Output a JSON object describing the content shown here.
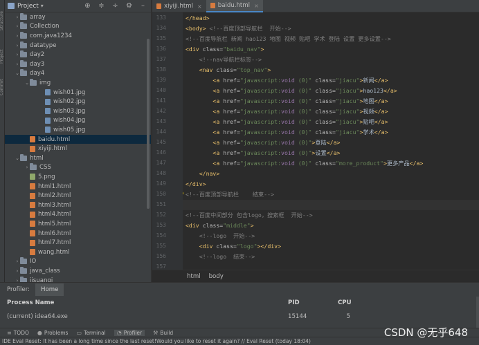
{
  "left_strip": {
    "tabs": [
      "Structure",
      "Project",
      "Commit"
    ]
  },
  "project_panel": {
    "title": "Project",
    "caret": "▾",
    "header_icons": [
      "target-icon",
      "collapse-icon",
      "expand-icon",
      "gear-icon",
      "minimize-icon"
    ]
  },
  "tree": [
    {
      "label": "array",
      "type": "folder",
      "arrow": "›",
      "indent": 1
    },
    {
      "label": "Collection",
      "type": "folder",
      "arrow": "›",
      "indent": 1
    },
    {
      "label": "com.java1234",
      "type": "folder",
      "arrow": "›",
      "indent": 1
    },
    {
      "label": "datatype",
      "type": "folder",
      "arrow": "›",
      "indent": 1
    },
    {
      "label": "day2",
      "type": "folder",
      "arrow": "›",
      "indent": 1
    },
    {
      "label": "day3",
      "type": "folder",
      "arrow": "›",
      "indent": 1
    },
    {
      "label": "day4",
      "type": "folder",
      "arrow": "⌄",
      "indent": 1
    },
    {
      "label": "img",
      "type": "folder",
      "arrow": "⌄",
      "indent": 2
    },
    {
      "label": "wish01.jpg",
      "type": "img",
      "arrow": "",
      "indent": 3
    },
    {
      "label": "wish02.jpg",
      "type": "img",
      "arrow": "",
      "indent": 3
    },
    {
      "label": "wish03.jpg",
      "type": "img",
      "arrow": "",
      "indent": 3
    },
    {
      "label": "wish04.jpg",
      "type": "img",
      "arrow": "",
      "indent": 3
    },
    {
      "label": "wish05.jpg",
      "type": "img",
      "arrow": "",
      "indent": 3
    },
    {
      "label": "baidu.html",
      "type": "html",
      "arrow": "",
      "indent": 2,
      "selected": true
    },
    {
      "label": "xiyiji.html",
      "type": "html",
      "arrow": "",
      "indent": 2
    },
    {
      "label": "html",
      "type": "folder",
      "arrow": "⌄",
      "indent": 1
    },
    {
      "label": "CSS",
      "type": "folder",
      "arrow": "›",
      "indent": 2
    },
    {
      "label": "5.png",
      "type": "png",
      "arrow": "",
      "indent": 2
    },
    {
      "label": "html1.html",
      "type": "html",
      "arrow": "",
      "indent": 2
    },
    {
      "label": "html2.html",
      "type": "html",
      "arrow": "",
      "indent": 2
    },
    {
      "label": "html3.html",
      "type": "html",
      "arrow": "",
      "indent": 2
    },
    {
      "label": "html4.html",
      "type": "html",
      "arrow": "",
      "indent": 2
    },
    {
      "label": "html5.html",
      "type": "html",
      "arrow": "",
      "indent": 2
    },
    {
      "label": "html6.html",
      "type": "html",
      "arrow": "",
      "indent": 2
    },
    {
      "label": "html7.html",
      "type": "html",
      "arrow": "",
      "indent": 2
    },
    {
      "label": "wang.html",
      "type": "html",
      "arrow": "",
      "indent": 2
    },
    {
      "label": "IO",
      "type": "folder",
      "arrow": "›",
      "indent": 1
    },
    {
      "label": "java_class",
      "type": "folder",
      "arrow": "›",
      "indent": 1
    },
    {
      "label": "jisuanqi",
      "type": "folder",
      "arrow": "›",
      "indent": 1
    }
  ],
  "editor_tabs": [
    {
      "label": "xiyiji.html",
      "active": false,
      "close": "×"
    },
    {
      "label": "baidu.html",
      "active": true,
      "close": "×"
    }
  ],
  "code_lines": [
    {
      "n": "133",
      "segs": [
        [
          "tg",
          "</head>"
        ]
      ]
    },
    {
      "n": "134",
      "segs": [
        [
          "tg",
          "<body>"
        ],
        [
          "cm",
          " <!--百度顶部导航栏  开始-->"
        ]
      ]
    },
    {
      "n": "135",
      "segs": [
        [
          "cm",
          "<!--百度导航栏 新闻 hao123 地图 视频 贴吧 学术 登陆 设置 更多设置-->"
        ]
      ]
    },
    {
      "n": "136",
      "segs": [
        [
          "tg",
          "<div "
        ],
        [
          "at",
          "class="
        ],
        [
          "av",
          "\"baidu_nav\""
        ],
        [
          "tg",
          ">"
        ]
      ]
    },
    {
      "n": "137",
      "segs": [
        [
          "cm",
          "    <!--nav导航栏标签-->"
        ]
      ]
    },
    {
      "n": "138",
      "segs": [
        [
          "tg",
          "    <nav "
        ],
        [
          "at",
          "class="
        ],
        [
          "av",
          "\"top_nav\""
        ],
        [
          "tg",
          ">"
        ]
      ]
    },
    {
      "n": "139",
      "segs": [
        [
          "tg",
          "        <a "
        ],
        [
          "at",
          "href="
        ],
        [
          "av",
          "\"javascript:"
        ],
        [
          "vd",
          "void "
        ],
        [
          "av",
          "(0)\" "
        ],
        [
          "at",
          "class="
        ],
        [
          "av",
          "\"jiacu\""
        ],
        [
          "tg",
          ">"
        ],
        [
          "tx",
          "新闻"
        ],
        [
          "tg",
          "</a>"
        ]
      ]
    },
    {
      "n": "140",
      "segs": [
        [
          "tg",
          "        <a "
        ],
        [
          "at",
          "href="
        ],
        [
          "av",
          "\"javascript:"
        ],
        [
          "vd",
          "void "
        ],
        [
          "av",
          "(0)\" "
        ],
        [
          "at",
          "class="
        ],
        [
          "av",
          "\"jiacu\""
        ],
        [
          "tg",
          ">"
        ],
        [
          "tx",
          "hao123"
        ],
        [
          "tg",
          "</a>"
        ]
      ]
    },
    {
      "n": "141",
      "segs": [
        [
          "tg",
          "        <a "
        ],
        [
          "at",
          "href="
        ],
        [
          "av",
          "\"javascript:"
        ],
        [
          "vd",
          "void "
        ],
        [
          "av",
          "(0)\" "
        ],
        [
          "at",
          "class="
        ],
        [
          "av",
          "\"jiacu\""
        ],
        [
          "tg",
          ">"
        ],
        [
          "tx",
          "地图"
        ],
        [
          "tg",
          "</a>"
        ]
      ]
    },
    {
      "n": "142",
      "segs": [
        [
          "tg",
          "        <a "
        ],
        [
          "at",
          "href="
        ],
        [
          "av",
          "\"javascript:"
        ],
        [
          "vd",
          "void "
        ],
        [
          "av",
          "(0)\" "
        ],
        [
          "at",
          "class="
        ],
        [
          "av",
          "\"jiacu\""
        ],
        [
          "tg",
          ">"
        ],
        [
          "tx",
          "视频"
        ],
        [
          "tg",
          "</a>"
        ]
      ]
    },
    {
      "n": "143",
      "segs": [
        [
          "tg",
          "        <a "
        ],
        [
          "at",
          "href="
        ],
        [
          "av",
          "\"javascript:"
        ],
        [
          "vd",
          "void "
        ],
        [
          "av",
          "(0)\" "
        ],
        [
          "at",
          "class="
        ],
        [
          "av",
          "\"jiacu\""
        ],
        [
          "tg",
          ">"
        ],
        [
          "tx",
          "贴吧"
        ],
        [
          "tg",
          "</a>"
        ]
      ]
    },
    {
      "n": "144",
      "segs": [
        [
          "tg",
          "        <a "
        ],
        [
          "at",
          "href="
        ],
        [
          "av",
          "\"javascript:"
        ],
        [
          "vd",
          "void "
        ],
        [
          "av",
          "(0)\" "
        ],
        [
          "at",
          "class="
        ],
        [
          "av",
          "\"jiacu\""
        ],
        [
          "tg",
          ">"
        ],
        [
          "tx",
          "学术"
        ],
        [
          "tg",
          "</a>"
        ]
      ]
    },
    {
      "n": "145",
      "segs": [
        [
          "tg",
          "        <a "
        ],
        [
          "at",
          "href="
        ],
        [
          "av",
          "\"javascript:"
        ],
        [
          "vd",
          "void "
        ],
        [
          "av",
          "(0)\""
        ],
        [
          "tg",
          ">"
        ],
        [
          "tx",
          "登陆"
        ],
        [
          "tg",
          "</a>"
        ]
      ]
    },
    {
      "n": "146",
      "segs": [
        [
          "tg",
          "        <a "
        ],
        [
          "at",
          "href="
        ],
        [
          "av",
          "\"javascript:"
        ],
        [
          "vd",
          "void "
        ],
        [
          "av",
          "(0)\""
        ],
        [
          "tg",
          ">"
        ],
        [
          "tx",
          "设置"
        ],
        [
          "tg",
          "</a>"
        ]
      ]
    },
    {
      "n": "147",
      "segs": [
        [
          "tg",
          "        <a "
        ],
        [
          "at",
          "href="
        ],
        [
          "av",
          "\"javascript:"
        ],
        [
          "vd",
          "void "
        ],
        [
          "av",
          "(0)\" "
        ],
        [
          "at",
          "class="
        ],
        [
          "av",
          "\"more_product\""
        ],
        [
          "tg",
          ">"
        ],
        [
          "tx",
          "更多产品"
        ],
        [
          "tg",
          "</a>"
        ]
      ]
    },
    {
      "n": "148",
      "segs": [
        [
          "tg",
          "    </nav>"
        ]
      ]
    },
    {
      "n": "149",
      "segs": [
        [
          "tg",
          "</div>"
        ]
      ]
    },
    {
      "n": "150",
      "segs": [
        [
          "cm",
          "<!--百度顶部导航栏    结束-->"
        ]
      ],
      "bulb": true
    },
    {
      "n": "151",
      "segs": [],
      "current": true
    },
    {
      "n": "152",
      "segs": [
        [
          "cm",
          "<!--百度中间部分 包含logo，搜索框  开始-->"
        ]
      ]
    },
    {
      "n": "153",
      "segs": [
        [
          "tg",
          "<div "
        ],
        [
          "at",
          "class="
        ],
        [
          "av",
          "\"middle\""
        ],
        [
          "tg",
          ">"
        ]
      ]
    },
    {
      "n": "154",
      "segs": [
        [
          "cm",
          "    <!--logo  开始-->"
        ]
      ]
    },
    {
      "n": "155",
      "segs": [
        [
          "tg",
          "    <div "
        ],
        [
          "at",
          "class="
        ],
        [
          "av",
          "\"logo\""
        ],
        [
          "tg",
          "></div>"
        ]
      ]
    },
    {
      "n": "156",
      "segs": [
        [
          "cm",
          "    <!--logo  结束-->"
        ]
      ]
    },
    {
      "n": "157",
      "segs": []
    }
  ],
  "breadcrumb": [
    "html",
    "body"
  ],
  "profiler": {
    "label": "Profiler:",
    "tab": "Home",
    "columns": {
      "name": "Process Name",
      "pid": "PID",
      "cpu": "CPU"
    },
    "rows": [
      {
        "name": "(current) idea64.exe",
        "pid": "15144",
        "cpu": "5"
      }
    ]
  },
  "bottom_tabs": [
    {
      "label": "TODO",
      "icon": "≡"
    },
    {
      "label": "Problems",
      "icon": "●"
    },
    {
      "label": "Terminal",
      "icon": "▭"
    },
    {
      "label": "Profiler",
      "icon": "◔",
      "active": true
    },
    {
      "label": "Build",
      "icon": "⚒"
    }
  ],
  "status": "IDE Eval Reset: It has been a long time since the last reset!Would you like to reset it again? // Eval Reset (today 18:04)",
  "watermark": "CSDN @无乎648",
  "colors": {
    "tag": "#e8bf6a",
    "attr_value": "#6a8759",
    "comment": "#808080",
    "selection": "#0d293e",
    "accent": "#4a88c7"
  }
}
